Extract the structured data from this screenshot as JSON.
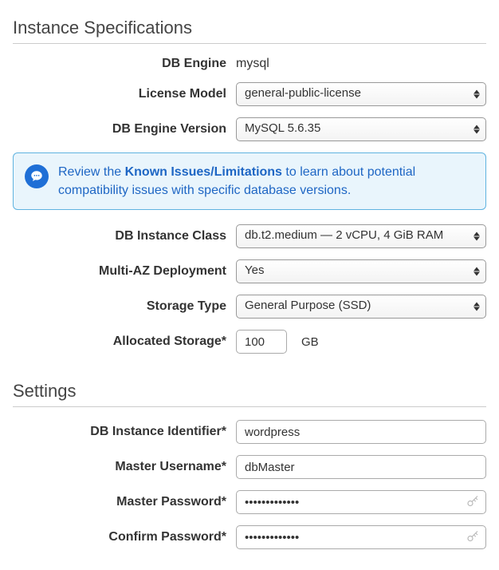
{
  "sections": {
    "instance": {
      "title": "Instance Specifications",
      "db_engine_label": "DB Engine",
      "db_engine_value": "mysql",
      "license_model_label": "License Model",
      "license_model_value": "general-public-license",
      "db_engine_version_label": "DB Engine Version",
      "db_engine_version_value": "MySQL 5.6.35",
      "alert": {
        "pre": "Review the ",
        "link": "Known Issues/Limitations",
        "post": " to learn about potential compatibility issues with specific database versions."
      },
      "db_instance_class_label": "DB Instance Class",
      "db_instance_class_value": "db.t2.medium — 2 vCPU, 4 GiB RAM",
      "multi_az_label": "Multi-AZ Deployment",
      "multi_az_value": "Yes",
      "storage_type_label": "Storage Type",
      "storage_type_value": "General Purpose (SSD)",
      "allocated_storage_label": "Allocated Storage*",
      "allocated_storage_value": "100",
      "allocated_storage_unit": "GB"
    },
    "settings": {
      "title": "Settings",
      "db_instance_identifier_label": "DB Instance Identifier*",
      "db_instance_identifier_value": "wordpress",
      "master_username_label": "Master Username*",
      "master_username_value": "dbMaster",
      "master_password_label": "Master Password*",
      "master_password_value": "•••••••••••••",
      "confirm_password_label": "Confirm Password*",
      "confirm_password_value": "•••••••••••••"
    }
  }
}
